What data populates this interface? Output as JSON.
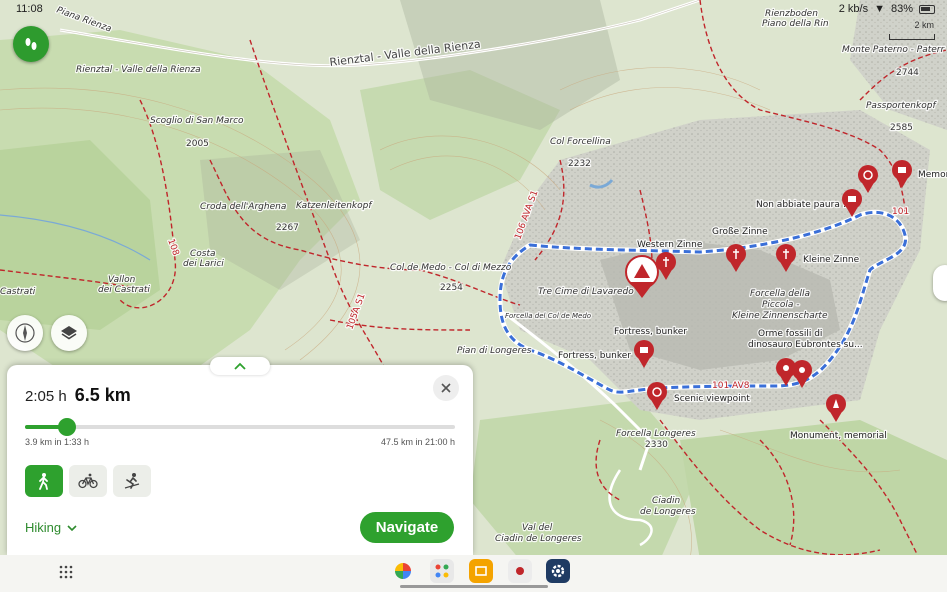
{
  "status": {
    "time": "11:08",
    "battery": "83%",
    "net": "2 kb/s"
  },
  "scale": {
    "label": "2 km"
  },
  "map_labels": {
    "rienztal_top": "Rienztal - Valle della Rienza",
    "rienztal_road": "Rienztal - Valle della Rienza",
    "scoglio": "Scoglio di San Marco",
    "ele_2005": "2005",
    "croda": "Croda dell'Arghena",
    "katzen": "Katzenleitenkopf",
    "ele_2267": "2267",
    "costa": "Costa",
    "costa2": "dei Larici",
    "vallon": "Vallon",
    "vallon2": "dei Castrati",
    "castrati": "Castrati",
    "colmedo": "Col de Medo - Col di Mezzo",
    "ele_2254": "2254",
    "col_forcellina": "Col Forcellina",
    "ele_2232": "2232",
    "tre_cime": "Tre Cime di Lavaredo",
    "forcella_medo": "Forcella del Col de Medo",
    "western": "Western Zinne",
    "grosse": "Große Zinne",
    "kleine": "Kleine Zinne",
    "non_abbiate": "Non abbiate paura !",
    "forcella_piccola1": "Forcella della",
    "forcella_piccola2": "Piccola -",
    "forcella_piccola3": "Kleine Zinnenscharte",
    "orme1": "Orme fossili di",
    "orme2": "dinosauro Eubrontes su...",
    "fortress1": "Fortress, bunker",
    "fortress2": "Fortress, bunker",
    "scenic": "Scenic viewpoint",
    "monument": "Monument, memorial",
    "memorial_short": "Memor",
    "pian": "Pian di Longeres",
    "forcella_longeres": "Forcella Longeres",
    "ele_2330": "2330",
    "cladin": "Ciadin",
    "cladin2": "de Longeres",
    "val_cladin": "Val del",
    "val_cladin2": "Ciadin de Longeres",
    "rienzboden": "Rienzboden",
    "piano_rin": "Piano della Rin",
    "monte_paterno": "Monte Paterno - Paterr",
    "ele_2744": "2744",
    "passporten": "Passportenkopf",
    "ele_2585": "2585",
    "route_106": "106 AVA S1",
    "route_101": "101 AV8",
    "route_105": "105A S1",
    "route_101b": "101",
    "piana_top": "Piana Rienza",
    "route_108": "108"
  },
  "sheet": {
    "duration": "2:05 h",
    "distance": "6.5 km",
    "slider_min": "3.9 km in 1:33 h",
    "slider_max": "47.5 km in 21:00 h",
    "slider_value": 0.097,
    "profile": "Hiking",
    "navigate_label": "Navigate"
  },
  "colors": {
    "accent": "#2ea12e",
    "route": "#3a6fd8",
    "marker": "#c0262b"
  }
}
